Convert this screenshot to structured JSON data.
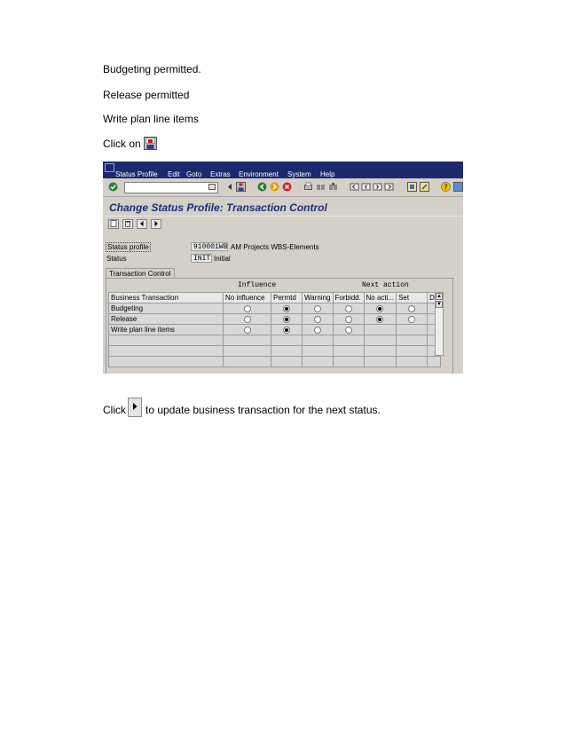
{
  "doc": {
    "line1": "Budgeting permitted.",
    "line2": "Release permitted",
    "line3": "Write plan line items",
    "click_on": "Click on",
    "click": "Click",
    "update_text": "to update business transaction for the next status."
  },
  "sap": {
    "menu": [
      "Status Profile",
      "Edit",
      "Goto",
      "Extras",
      "Environment",
      "System",
      "Help"
    ],
    "title": "Change Status Profile: Transaction Control",
    "fields": {
      "status_profile_label": "Status profile",
      "status_profile_value": "910001WB",
      "status_profile_desc": "AM Projects WBS-Elements",
      "status_label": "Status",
      "status_value": "INIT",
      "status_desc": "Initial"
    },
    "tab_label": "Transaction Control",
    "group_influence": "Influence",
    "group_next_action": "Next action",
    "columns": [
      "Business Transaction",
      "No influence",
      "Permtd",
      "Warning",
      "Forbidd.",
      "No acti...",
      "Set",
      "De"
    ],
    "rows": [
      {
        "name": "Budgeting",
        "selected_influence": "Permtd",
        "selected_next": "No acti..."
      },
      {
        "name": "Release",
        "selected_influence": "Permtd",
        "selected_next": "No acti..."
      },
      {
        "name": "Write plan line items",
        "selected_influence": "Permtd",
        "selected_next": ""
      }
    ],
    "icons": {
      "save": "save-floppy-icon",
      "next": "next-arrow-icon",
      "enter": "enter-check-icon"
    },
    "colors": {
      "menubar": "#1b2a6e",
      "title": "#1e2f7a"
    }
  }
}
